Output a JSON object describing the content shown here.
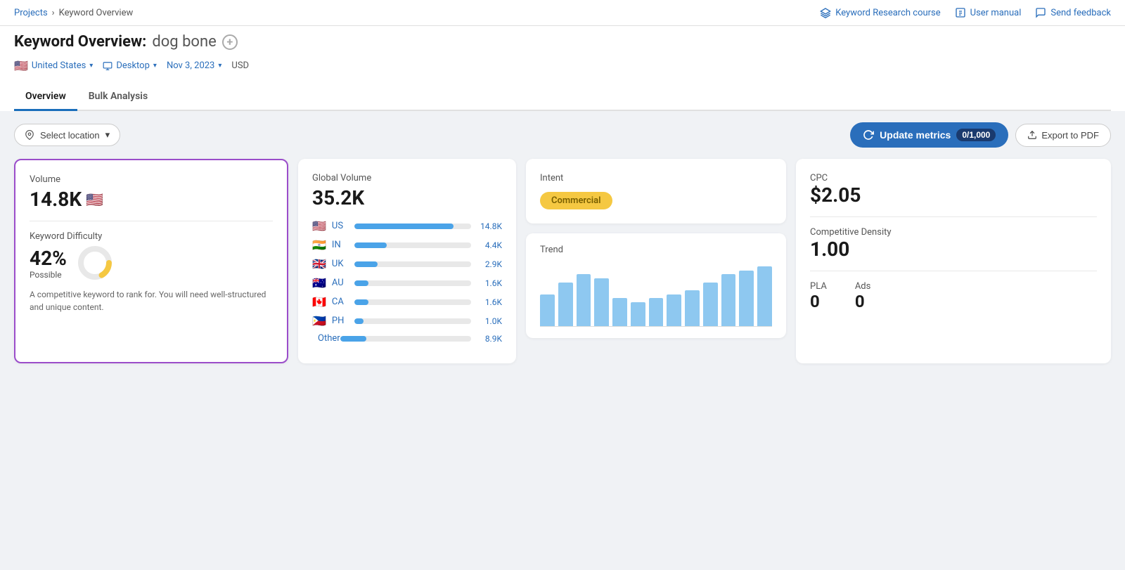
{
  "topbar": {
    "breadcrumb_home": "Projects",
    "breadcrumb_sep": "›",
    "breadcrumb_current": "Keyword Overview",
    "link_course": "Keyword Research course",
    "link_manual": "User manual",
    "link_feedback": "Send feedback"
  },
  "header": {
    "title_prefix": "Keyword Overview:",
    "keyword": "dog bone",
    "filter_country": "United States",
    "filter_device": "Desktop",
    "filter_date": "Nov 3, 2023",
    "filter_currency": "USD"
  },
  "tabs": {
    "items": [
      {
        "label": "Overview",
        "active": true
      },
      {
        "label": "Bulk Analysis",
        "active": false
      }
    ]
  },
  "toolbar": {
    "select_location_label": "Select location",
    "update_metrics_label": "Update metrics",
    "update_counter": "0/1,000",
    "export_label": "Export to PDF"
  },
  "cards": {
    "volume": {
      "label": "Volume",
      "value": "14.8K",
      "flag": "🇺🇸"
    },
    "keyword_difficulty": {
      "label": "Keyword Difficulty",
      "percent": "42%",
      "sub_label": "Possible",
      "donut_fill": 42,
      "description": "A competitive keyword to rank for. You will need well-structured and unique content."
    },
    "global_volume": {
      "label": "Global Volume",
      "value": "35.2K",
      "countries": [
        {
          "flag": "🇺🇸",
          "code": "US",
          "bar": 85,
          "value": "14.8K"
        },
        {
          "flag": "🇮🇳",
          "code": "IN",
          "bar": 28,
          "value": "4.4K"
        },
        {
          "flag": "🇬🇧",
          "code": "UK",
          "bar": 20,
          "value": "2.9K"
        },
        {
          "flag": "🇦🇺",
          "code": "AU",
          "bar": 12,
          "value": "1.6K"
        },
        {
          "flag": "🇨🇦",
          "code": "CA",
          "bar": 12,
          "value": "1.6K"
        },
        {
          "flag": "🇵🇭",
          "code": "PH",
          "bar": 8,
          "value": "1.0K"
        },
        {
          "flag": "",
          "code": "Other",
          "bar": 20,
          "value": "8.9K"
        }
      ]
    },
    "intent": {
      "label": "Intent",
      "badge": "Commercial"
    },
    "trend": {
      "label": "Trend",
      "bars": [
        40,
        55,
        65,
        60,
        35,
        30,
        35,
        40,
        45,
        55,
        65,
        70,
        75
      ]
    },
    "cpc": {
      "label": "CPC",
      "value": "$2.05"
    },
    "competitive_density": {
      "label": "Competitive Density",
      "value": "1.00"
    },
    "pla": {
      "label": "PLA",
      "value": "0"
    },
    "ads": {
      "label": "Ads",
      "value": "0"
    }
  }
}
